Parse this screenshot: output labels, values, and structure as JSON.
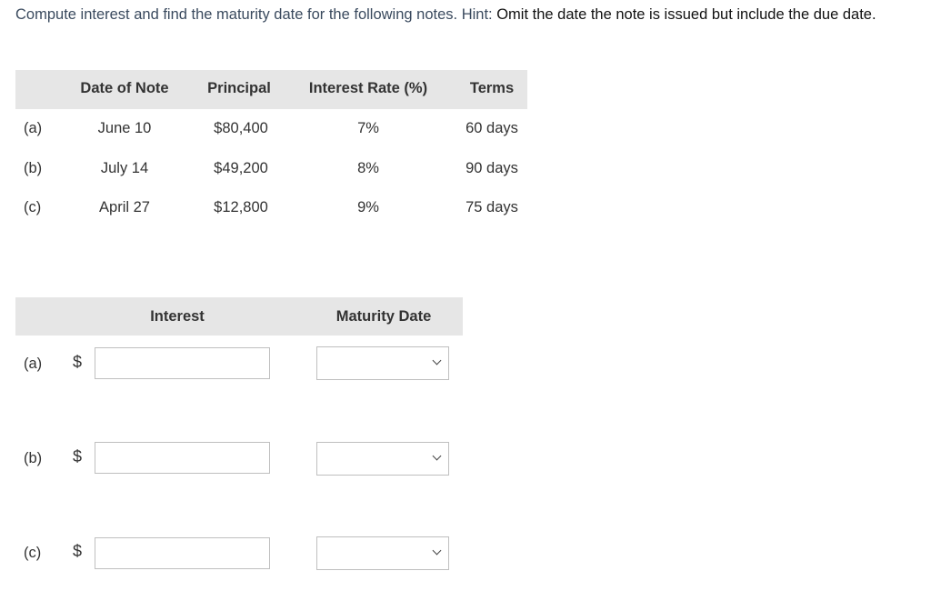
{
  "instructions": {
    "lead": "Compute interest and find the maturity date for the following notes. Hint: ",
    "hint": "Omit the date the note is issued but include the due date."
  },
  "notes_table": {
    "headers": [
      "Date of Note",
      "Principal",
      "Interest Rate (%)",
      "Terms"
    ],
    "rows": [
      {
        "label": "(a)",
        "date": "June 10",
        "principal": "$80,400",
        "rate": "7%",
        "terms": "60 days"
      },
      {
        "label": "(b)",
        "date": "July 14",
        "principal": "$49,200",
        "rate": "8%",
        "terms": "90 days"
      },
      {
        "label": "(c)",
        "date": "April 27",
        "principal": "$12,800",
        "rate": "9%",
        "terms": "75 days"
      }
    ]
  },
  "answer_table": {
    "headers": [
      "Interest",
      "Maturity Date"
    ],
    "currency_symbol": "$",
    "rows": [
      {
        "label": "(a)",
        "interest_value": "",
        "maturity_value": ""
      },
      {
        "label": "(b)",
        "interest_value": "",
        "maturity_value": ""
      },
      {
        "label": "(c)",
        "interest_value": "",
        "maturity_value": ""
      }
    ]
  }
}
